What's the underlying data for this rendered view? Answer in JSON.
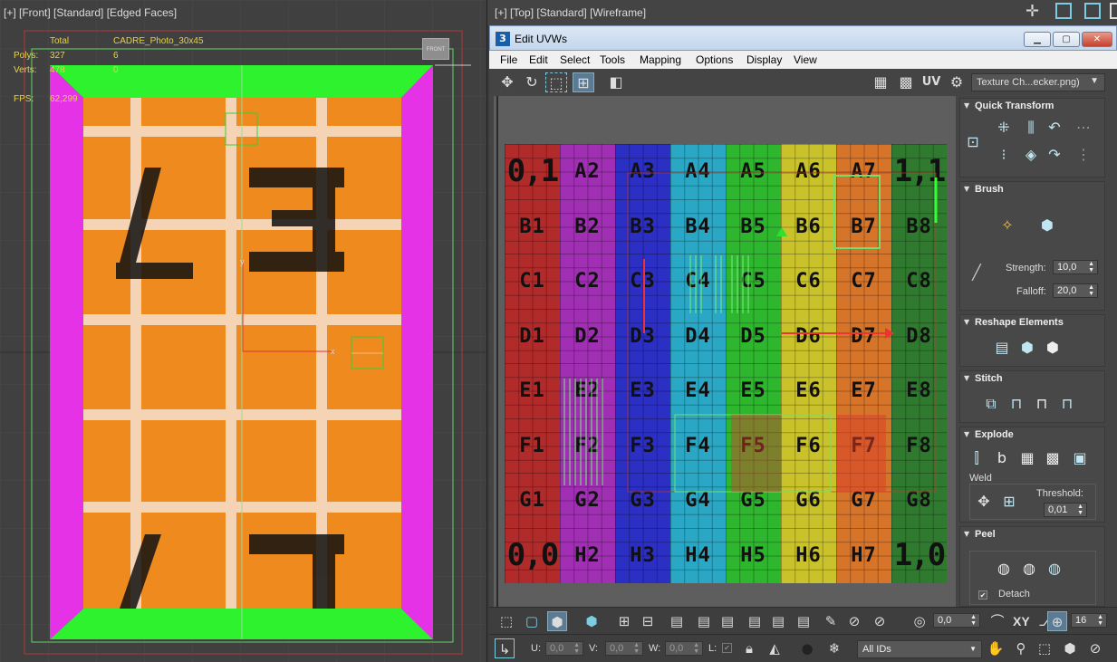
{
  "left_viewport": {
    "label": "[+] [Front] [Standard] [Edged Faces]",
    "stats": {
      "total_label": "Total",
      "object_name": "CADRE_Photo_30x45",
      "polys_label": "Polys:",
      "polys_total": "327",
      "polys_selected": "6",
      "verts_label": "Verts:",
      "verts_total": "478",
      "verts_selected": "0",
      "fps_label": "FPS:",
      "fps_value": "62,299"
    },
    "view_cube_label": "FRONT"
  },
  "top_viewport": {
    "label": "[+] [Top] [Standard] [Wireframe]"
  },
  "uvw_window": {
    "title": "Edit UVWs",
    "title_icon": "3",
    "menu": [
      "File",
      "Edit",
      "Select",
      "Tools",
      "Mapping",
      "Options",
      "Display",
      "View"
    ],
    "toolbar": {
      "uv_label": "UV",
      "texture_dropdown": "Texture Ch...ecker.png)"
    },
    "checker_rows": [
      [
        "0,1",
        "A2",
        "A3",
        "A4",
        "A5",
        "A6",
        "A7",
        "1,1"
      ],
      [
        "B1",
        "B2",
        "B3",
        "B4",
        "B5",
        "B6",
        "B7",
        "B8"
      ],
      [
        "C1",
        "C2",
        "C3",
        "C4",
        "C5",
        "C6",
        "C7",
        "C8"
      ],
      [
        "D1",
        "D2",
        "D3",
        "D4",
        "D5",
        "D6",
        "D7",
        "D8"
      ],
      [
        "E1",
        "E2",
        "E3",
        "E4",
        "E5",
        "E6",
        "E7",
        "E8"
      ],
      [
        "F1",
        "F2",
        "F3",
        "F4",
        "F5",
        "F6",
        "F7",
        "F8"
      ],
      [
        "G1",
        "G2",
        "G3",
        "G4",
        "G5",
        "G6",
        "G7",
        "G8"
      ],
      [
        "0,0",
        "H2",
        "H3",
        "H4",
        "H5",
        "H6",
        "H7",
        "1,0"
      ]
    ],
    "column_colors": [
      "#b22b2b",
      "#a12fb4",
      "#2c2fc4",
      "#2aa7c4",
      "#2fb62f",
      "#c9c22b",
      "#d6742a",
      "#2f7a2f"
    ],
    "panel": {
      "quick_transform": {
        "title": "Quick Transform"
      },
      "brush": {
        "title": "Brush",
        "strength_label": "Strength:",
        "strength_value": "10,0",
        "falloff_label": "Falloff:",
        "falloff_value": "20,0"
      },
      "reshape": {
        "title": "Reshape Elements"
      },
      "stitch": {
        "title": "Stitch"
      },
      "explode": {
        "title": "Explode",
        "weld_label": "Weld",
        "threshold_label": "Threshold:",
        "threshold_value": "0,01"
      },
      "peel": {
        "title": "Peel",
        "detach_label": "Detach"
      }
    },
    "bottom_toolbar": {
      "angle_value": "0,0",
      "xy_label": "XY",
      "grid_value": "16"
    },
    "status_bar": {
      "u_label": "U:",
      "u_value": "0,0",
      "v_label": "V:",
      "v_value": "0,0",
      "w_label": "W:",
      "w_value": "0,0",
      "l_label": "L:",
      "ids_dropdown": "All IDs"
    }
  }
}
